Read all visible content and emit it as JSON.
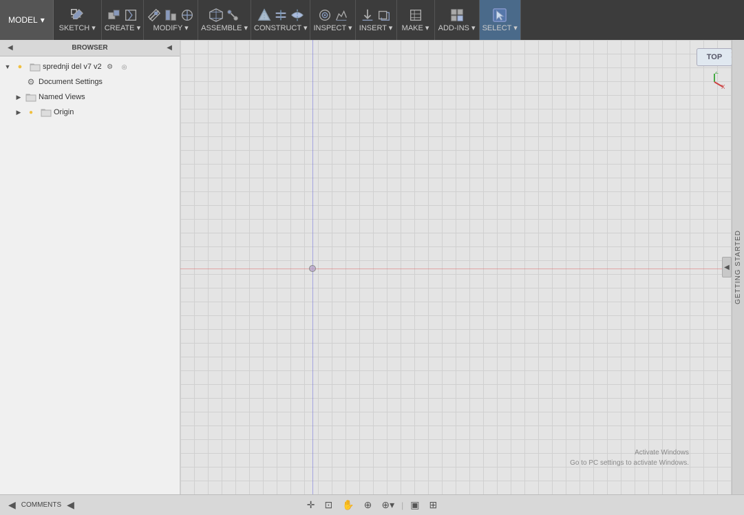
{
  "toolbar": {
    "model_label": "MODEL",
    "model_arrow": "▾",
    "groups": [
      {
        "id": "sketch",
        "label": "SKETCH",
        "has_arrow": true,
        "icon": "✏"
      },
      {
        "id": "create",
        "label": "CREATE",
        "has_arrow": true,
        "icon": "◻"
      },
      {
        "id": "modify",
        "label": "MODIFY",
        "has_arrow": true,
        "icon": "⌗"
      },
      {
        "id": "assemble",
        "label": "ASSEMBLE",
        "has_arrow": true,
        "icon": "⚙"
      },
      {
        "id": "construct",
        "label": "CONSTRUCT",
        "has_arrow": true,
        "icon": "△"
      },
      {
        "id": "inspect",
        "label": "INSPECT",
        "has_arrow": true,
        "icon": "◎"
      },
      {
        "id": "insert",
        "label": "INSERT",
        "has_arrow": true,
        "icon": "↓"
      },
      {
        "id": "make",
        "label": "MAKE",
        "has_arrow": true,
        "icon": "▤"
      },
      {
        "id": "addins",
        "label": "ADD-INS",
        "has_arrow": true,
        "icon": "⊞"
      },
      {
        "id": "select",
        "label": "SELECT",
        "has_arrow": true,
        "icon": "↖",
        "active": true
      }
    ]
  },
  "browser": {
    "title": "BROWSER",
    "nav_back": "◀",
    "nav_forward": "▶",
    "collapse_icon": "◀",
    "expand_icon": "▶",
    "tree": [
      {
        "id": "root",
        "toggle": "▼",
        "icon_type": "circle_yellow",
        "extra_icon": "folder",
        "label": "sprednji del v7 v2",
        "has_settings": true,
        "level": "root"
      },
      {
        "id": "doc_settings",
        "toggle": "",
        "icon_type": "settings",
        "label": "Document Settings",
        "level": "level1"
      },
      {
        "id": "named_views",
        "toggle": "▶",
        "icon_type": "folder",
        "label": "Named Views",
        "level": "level1"
      },
      {
        "id": "origin",
        "toggle": "▶",
        "icon_type": "circle_yellow_small",
        "label": "Origin",
        "level": "level1",
        "folder": true
      }
    ]
  },
  "viewport": {
    "view_label": "TOP",
    "axes": {
      "z_label": "Z",
      "y_label": "Y",
      "x_label": "X"
    }
  },
  "statusbar": {
    "left_label": "COMMENTS",
    "left_icon": "◀",
    "tools": [
      {
        "id": "pan",
        "icon": "✛",
        "label": "pan"
      },
      {
        "id": "fit",
        "icon": "⊡",
        "label": "fit"
      },
      {
        "id": "hand",
        "icon": "✋",
        "label": "hand"
      },
      {
        "id": "zoom",
        "icon": "⊕",
        "label": "zoom"
      },
      {
        "id": "zoom2",
        "icon": "⊕▾",
        "label": "zoom-menu"
      }
    ],
    "right_tools": [
      {
        "id": "display1",
        "icon": "▣",
        "label": "display1"
      },
      {
        "id": "display2",
        "icon": "⊞",
        "label": "display2"
      }
    ]
  },
  "getting_started": {
    "label": "GETTING STARTED",
    "collapse_icon": "◀"
  },
  "watermark": {
    "line1": "Activate Windows",
    "line2": "Go to PC settings to activate Windows."
  },
  "close_btn": "✕"
}
